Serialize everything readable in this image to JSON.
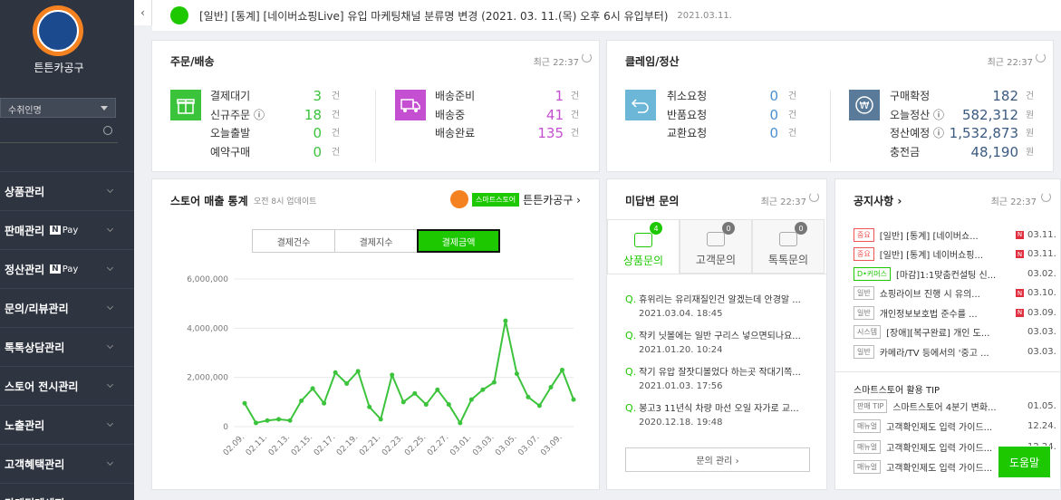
{
  "sidebar": {
    "store_name": "튼튼카공구",
    "select_value": "수취인명",
    "menu": [
      {
        "label": "상품관리",
        "pay": ""
      },
      {
        "label": "판매관리",
        "pay": "Pay"
      },
      {
        "label": "정산관리",
        "pay": "Pay"
      },
      {
        "label": "문의/리뷰관리",
        "pay": ""
      },
      {
        "label": "톡톡상담관리",
        "pay": ""
      },
      {
        "label": "스토어 전시관리",
        "pay": ""
      },
      {
        "label": "노출관리",
        "pay": ""
      },
      {
        "label": "고객혜택관리",
        "pay": ""
      },
      {
        "label": "마케팅메세지",
        "pay": ""
      }
    ],
    "npay_n": "N"
  },
  "notice": {
    "text": "[일반] [통계] [네이버쇼핑Live] 유입 마케팅채널 분류명 변경 (2021. 03. 11.(목) 오후 6시 유입부터)",
    "date": "2021.03.11."
  },
  "orders": {
    "title": "주문/배송",
    "recent": "최근 22:37",
    "left": [
      {
        "label": "결제대기",
        "value": "3",
        "unit": "건"
      },
      {
        "label": "신규주문 ⓘ",
        "value": "18",
        "unit": "건"
      },
      {
        "label": "오늘출발",
        "value": "0",
        "unit": "건"
      },
      {
        "label": "예약구매",
        "value": "0",
        "unit": "건"
      }
    ],
    "right": [
      {
        "label": "배송준비",
        "value": "1",
        "unit": "건"
      },
      {
        "label": "배송중",
        "value": "41",
        "unit": "건"
      },
      {
        "label": "배송완료",
        "value": "135",
        "unit": "건"
      }
    ]
  },
  "claims": {
    "title": "클레임/정산",
    "recent": "최근 22:37",
    "left": [
      {
        "label": "취소요청",
        "value": "0",
        "unit": "건"
      },
      {
        "label": "반품요청",
        "value": "0",
        "unit": "건"
      },
      {
        "label": "교환요청",
        "value": "0",
        "unit": "건"
      }
    ],
    "right": [
      {
        "label": "구매확정",
        "value": "182",
        "unit": "건"
      },
      {
        "label": "오늘정산 ⓘ",
        "value": "582,312",
        "unit": "원"
      },
      {
        "label": "정산예정 ⓘ",
        "value": "1,532,873",
        "unit": "원"
      },
      {
        "label": "충전금",
        "value": "48,190",
        "unit": "원"
      }
    ]
  },
  "sales": {
    "title": "스토어 매출 통계",
    "update": "오전 8시 업데이트",
    "smartstore_badge": "스마트스토어",
    "store_link": "튼튼카공구 ›",
    "tabs": [
      "결제건수",
      "결제지수",
      "결제금액"
    ],
    "active_tab": 2
  },
  "chart_data": {
    "type": "line",
    "color": "#3cc33c",
    "ylim": [
      0,
      6000000
    ],
    "y_ticks": [
      "6,000,000",
      "4,000,000",
      "2,000,000",
      "0"
    ],
    "y_tick_values": [
      6000000,
      4000000,
      2000000,
      0
    ],
    "x_tick_labels": [
      "02.09.",
      "02.11.",
      "02.13.",
      "02.15.",
      "02.17.",
      "02.19.",
      "02.21.",
      "02.23.",
      "02.25.",
      "02.27.",
      "03.01.",
      "03.03.",
      "03.05.",
      "03.07.",
      "03.09."
    ],
    "x": [
      "02.09.",
      "02.10.",
      "02.11.",
      "02.12.",
      "02.13.",
      "02.14.",
      "02.15.",
      "02.16.",
      "02.17.",
      "02.18.",
      "02.19.",
      "02.20.",
      "02.21.",
      "02.22.",
      "02.23.",
      "02.24.",
      "02.25.",
      "02.26.",
      "02.27.",
      "02.28.",
      "03.01.",
      "03.02.",
      "03.03.",
      "03.04.",
      "03.05.",
      "03.06.",
      "03.07.",
      "03.08.",
      "03.09.",
      "03.10."
    ],
    "values": [
      950000,
      150000,
      250000,
      300000,
      250000,
      1050000,
      1550000,
      950000,
      2200000,
      1750000,
      2250000,
      800000,
      300000,
      2100000,
      1000000,
      1350000,
      900000,
      1500000,
      900000,
      150000,
      1100000,
      1500000,
      1800000,
      4300000,
      2150000,
      1200000,
      850000,
      1600000,
      2300000,
      1100000
    ]
  },
  "qna": {
    "title": "미답변 문의",
    "recent": "최근 22:37",
    "tabs": [
      {
        "label": "상품문의",
        "count": "4"
      },
      {
        "label": "고객문의",
        "count": "0"
      },
      {
        "label": "톡톡문의",
        "count": "0"
      }
    ],
    "q_mark": "Q.",
    "items": [
      {
        "text": "휴위리는 유리재질인건 알겠는데 안경알 ...",
        "date": "2021.03.04. 18:45"
      },
      {
        "text": "작키 닛볼에는 일반 구리스 넣으면되나요...",
        "date": "2021.01.20. 10:24"
      },
      {
        "text": "작기 유압 잘잣디볼었다 하는곳 작대기쪽...",
        "date": "2021.01.03. 17:56"
      },
      {
        "text": "봉고3 11년식 차량 마선 오일 자가로 교...",
        "date": "2020.12.18. 19:48"
      }
    ],
    "more": "문의 관리 ›"
  },
  "notices": {
    "title": "공지사항 ›",
    "recent": "최근 22:37",
    "items": [
      {
        "tag": "중요",
        "tagtype": "red",
        "text": "[일반] [통계] [네이버쇼...",
        "new": true,
        "date": "03.11."
      },
      {
        "tag": "중요",
        "tagtype": "red",
        "text": "[일반] [통계] 네이버쇼핑...",
        "new": true,
        "date": "03.11."
      },
      {
        "tag": "D•커머스",
        "tagtype": "green",
        "text": "[마감]1:1맞춤컨설팅 신...",
        "new": false,
        "date": "03.02."
      },
      {
        "tag": "일반",
        "tagtype": "",
        "text": "쇼핑라이브 진행 시 유의...",
        "new": true,
        "date": "03.10."
      },
      {
        "tag": "일반",
        "tagtype": "",
        "text": "개인정보보호법 준수를 ...",
        "new": true,
        "date": "03.09."
      },
      {
        "tag": "시스템",
        "tagtype": "",
        "text": "[장애][복구완료] 개인 도...",
        "new": false,
        "date": "03.03."
      },
      {
        "tag": "일반",
        "tagtype": "",
        "text": "카메라/TV 등에서의 '중고 ...",
        "new": false,
        "date": "03.03."
      }
    ],
    "new_mark": "N",
    "tip_title": "스마트스토어 활용 TIP",
    "tips": [
      {
        "tag": "판매 TIP",
        "text": "스마트스토어 4분기 변화...",
        "date": "01.05."
      },
      {
        "tag": "매뉴얼",
        "text": "고객확인제도 입력 가이드...",
        "date": "12.24."
      },
      {
        "tag": "매뉴얼",
        "text": "고객확인제도 입력 가이드...",
        "date": "12.24."
      },
      {
        "tag": "매뉴얼",
        "text": "고객확인제도 입력 가이드...",
        "date": ""
      }
    ]
  },
  "help": "도움말",
  "colors": {
    "accent": "#1ec800",
    "sidebar": "#2e3440",
    "orders_value": "#3cc33c",
    "delivery_value": "#c44fd0",
    "claims_value": "#4a90d0",
    "settle_value": "#3b5a80"
  }
}
